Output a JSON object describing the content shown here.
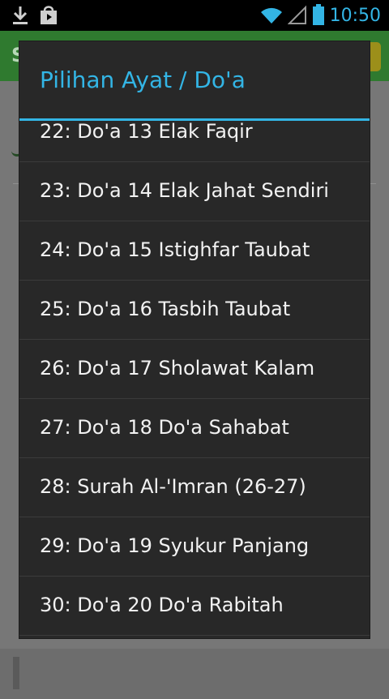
{
  "status_bar": {
    "icons_left": [
      "download-icon",
      "store-bag-icon"
    ],
    "icons_right": [
      "wifi-icon",
      "signal-icon",
      "battery-icon"
    ],
    "time": "10:50"
  },
  "background_app": {
    "title_initial": "S"
  },
  "dialog": {
    "title": "Pilihan Ayat / Do'a",
    "items": [
      {
        "label": "22: Do'a 13 Elak Faqir"
      },
      {
        "label": "23: Do'a 14 Elak Jahat Sendiri"
      },
      {
        "label": "24: Do'a 15 Istighfar Taubat"
      },
      {
        "label": "25: Do'a 16 Tasbih Taubat"
      },
      {
        "label": "26: Do'a 17 Sholawat Kalam"
      },
      {
        "label": "27: Do'a 18 Do'a Sahabat"
      },
      {
        "label": "28: Surah Al-'Imran (26-27)"
      },
      {
        "label": "29: Do'a 19 Syukur Panjang"
      },
      {
        "label": "30: Do'a 20 Do'a Rabitah"
      }
    ]
  },
  "colors": {
    "accent": "#33b5e5",
    "dialog_bg": "#282828",
    "item_text": "#f2f2f2"
  }
}
